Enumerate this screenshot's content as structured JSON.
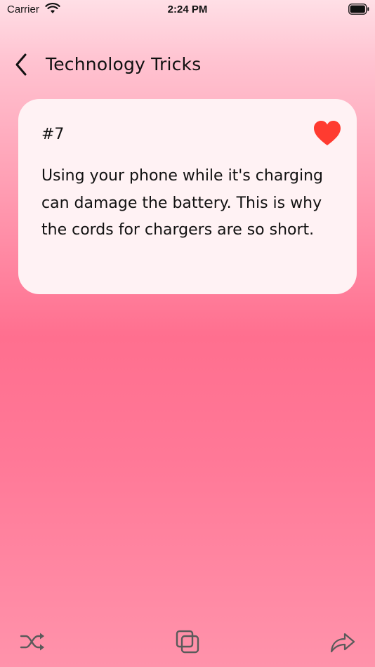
{
  "status_bar": {
    "carrier": "Carrier",
    "time": "2:24 PM"
  },
  "header": {
    "title": "Technology Tricks",
    "back_icon": "chevron-left-icon"
  },
  "card": {
    "number": "#7",
    "favorite_icon": "heart-icon",
    "favorite_color": "#ff3b30",
    "text": "Using your phone while it's charging can damage the battery. This is why the cords for chargers are so short."
  },
  "toolbar": {
    "shuffle_icon": "shuffle-icon",
    "copy_icon": "copy-icon",
    "share_icon": "share-icon"
  },
  "colors": {
    "background_top": "#ffdfe6",
    "background_mid": "#ff6f8f",
    "background_bottom": "#ff93ab",
    "card_background": "#fff2f4",
    "icon_color": "#5a5a5a"
  }
}
